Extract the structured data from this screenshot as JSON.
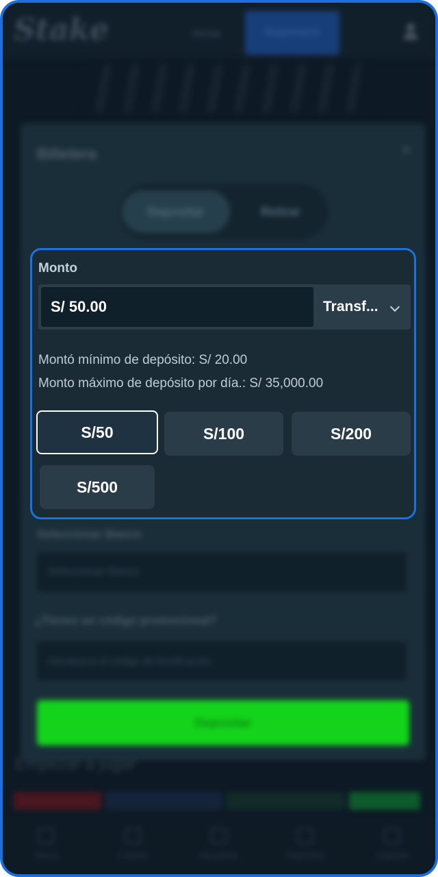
{
  "header": {
    "logo_text": "Stake",
    "login_label": "Iniciar",
    "register_label": "Registrarse"
  },
  "wallet": {
    "title": "Billetera",
    "close_glyph": "×",
    "tabs": [
      {
        "label": "Depositar",
        "active": true
      },
      {
        "label": "Retirar",
        "active": false
      }
    ],
    "amount_section": {
      "label": "Monto",
      "amount_value": "S/ 50.00",
      "method_value": "Transf...",
      "min_text": "Montó mínimo de depósito: S/ 20.00",
      "max_text": "Monto máximo de depósito por día.: S/ 35,000.00",
      "quick_amounts": [
        {
          "label": "S/50",
          "selected": true
        },
        {
          "label": "S/100",
          "selected": false
        },
        {
          "label": "S/200",
          "selected": false
        },
        {
          "label": "S/500",
          "selected": false
        }
      ]
    },
    "bank": {
      "label": "Seleccionar Banco",
      "placeholder": "Seleccionar Banco"
    },
    "promo": {
      "label": "¿Tienes un código promocional?",
      "placeholder": "Introduzca el código de bonificación"
    },
    "deposit_button_label": "Depositar"
  },
  "start_text": "Empezar a jugar",
  "bottom_nav": [
    {
      "label": "Menú",
      "icon": "menu-icon"
    },
    {
      "label": "Casino",
      "icon": "casino-icon"
    },
    {
      "label": "Apuestas",
      "icon": "bets-icon"
    },
    {
      "label": "Deportes",
      "icon": "sports-icon"
    },
    {
      "label": "Soporte",
      "icon": "support-icon"
    }
  ],
  "colors": {
    "accent_border": "#1a72e0",
    "deposit_green": "#13d41a",
    "card_bg": "#1b2b36"
  }
}
